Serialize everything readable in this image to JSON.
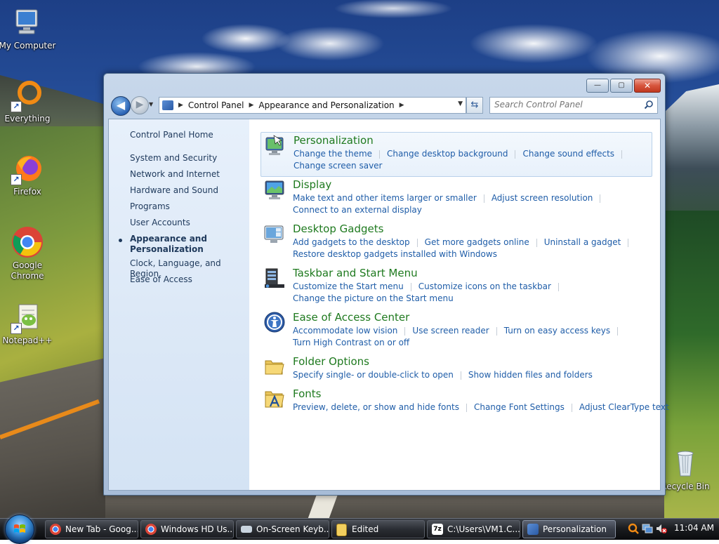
{
  "desktop": {
    "icons": [
      {
        "label": "My Computer"
      },
      {
        "label": "Everything"
      },
      {
        "label": "Firefox"
      },
      {
        "label": "Google Chrome"
      },
      {
        "label": "Notepad++"
      },
      {
        "label": "Recycle Bin"
      }
    ]
  },
  "window": {
    "buttons": {
      "minimize": "—",
      "maximize": "▢",
      "close": "✕"
    },
    "nav": {
      "back": "◀",
      "forward": "▶",
      "dropdown": "▼"
    },
    "address": {
      "crumbs": [
        "Control Panel",
        "Appearance and Personalization"
      ],
      "separator": "▶",
      "dropdown": "▼"
    },
    "refresh": "⇆",
    "search": {
      "placeholder": "Search Control Panel"
    }
  },
  "sidebar": {
    "home": "Control Panel Home",
    "items": [
      "System and Security",
      "Network and Internet",
      "Hardware and Sound",
      "Programs",
      "User Accounts",
      "Appearance and Personalization",
      "Clock, Language, and Region",
      "Ease of Access"
    ],
    "active_index": 5
  },
  "categories": [
    {
      "title": "Personalization",
      "icon": "personalization-icon",
      "rows": [
        [
          "Change the theme",
          "Change desktop background",
          "Change sound effects"
        ],
        [
          "Change screen saver"
        ]
      ]
    },
    {
      "title": "Display",
      "icon": "display-icon",
      "rows": [
        [
          "Make text and other items larger or smaller",
          "Adjust screen resolution"
        ],
        [
          "Connect to an external display"
        ]
      ]
    },
    {
      "title": "Desktop Gadgets",
      "icon": "gadgets-icon",
      "rows": [
        [
          "Add gadgets to the desktop",
          "Get more gadgets online",
          "Uninstall a gadget"
        ],
        [
          "Restore desktop gadgets installed with Windows"
        ]
      ]
    },
    {
      "title": "Taskbar and Start Menu",
      "icon": "taskbar-icon",
      "rows": [
        [
          "Customize the Start menu",
          "Customize icons on the taskbar"
        ],
        [
          "Change the picture on the Start menu"
        ]
      ]
    },
    {
      "title": "Ease of Access Center",
      "icon": "ease-of-access-icon",
      "rows": [
        [
          "Accommodate low vision",
          "Use screen reader",
          "Turn on easy access keys"
        ],
        [
          "Turn High Contrast on or off"
        ]
      ]
    },
    {
      "title": "Folder Options",
      "icon": "folder-options-icon",
      "rows": [
        [
          "Specify single- or double-click to open",
          "Show hidden files and folders"
        ]
      ]
    },
    {
      "title": "Fonts",
      "icon": "fonts-icon",
      "rows": [
        [
          "Preview, delete, or show and hide fonts",
          "Change Font Settings",
          "Adjust ClearType text"
        ]
      ]
    }
  ],
  "taskbar": {
    "tasks": [
      {
        "label": "New Tab - Goog...",
        "icon": "chrome-icon"
      },
      {
        "label": "Windows HD Us...",
        "icon": "chrome-icon"
      },
      {
        "label": "On-Screen Keyb...",
        "icon": "keyboard-icon"
      },
      {
        "label": "Edited",
        "icon": "folder-icon"
      },
      {
        "label": "C:\\Users\\VM1.C...",
        "icon": "7zip-icon"
      },
      {
        "label": "Personalization",
        "icon": "control-panel-icon"
      }
    ],
    "active_index": 5,
    "clock": "11:04 AM"
  },
  "colors": {
    "category_title": "#1f7a1f",
    "link": "#1f5da8",
    "sidebar_text": "#1e395b"
  }
}
